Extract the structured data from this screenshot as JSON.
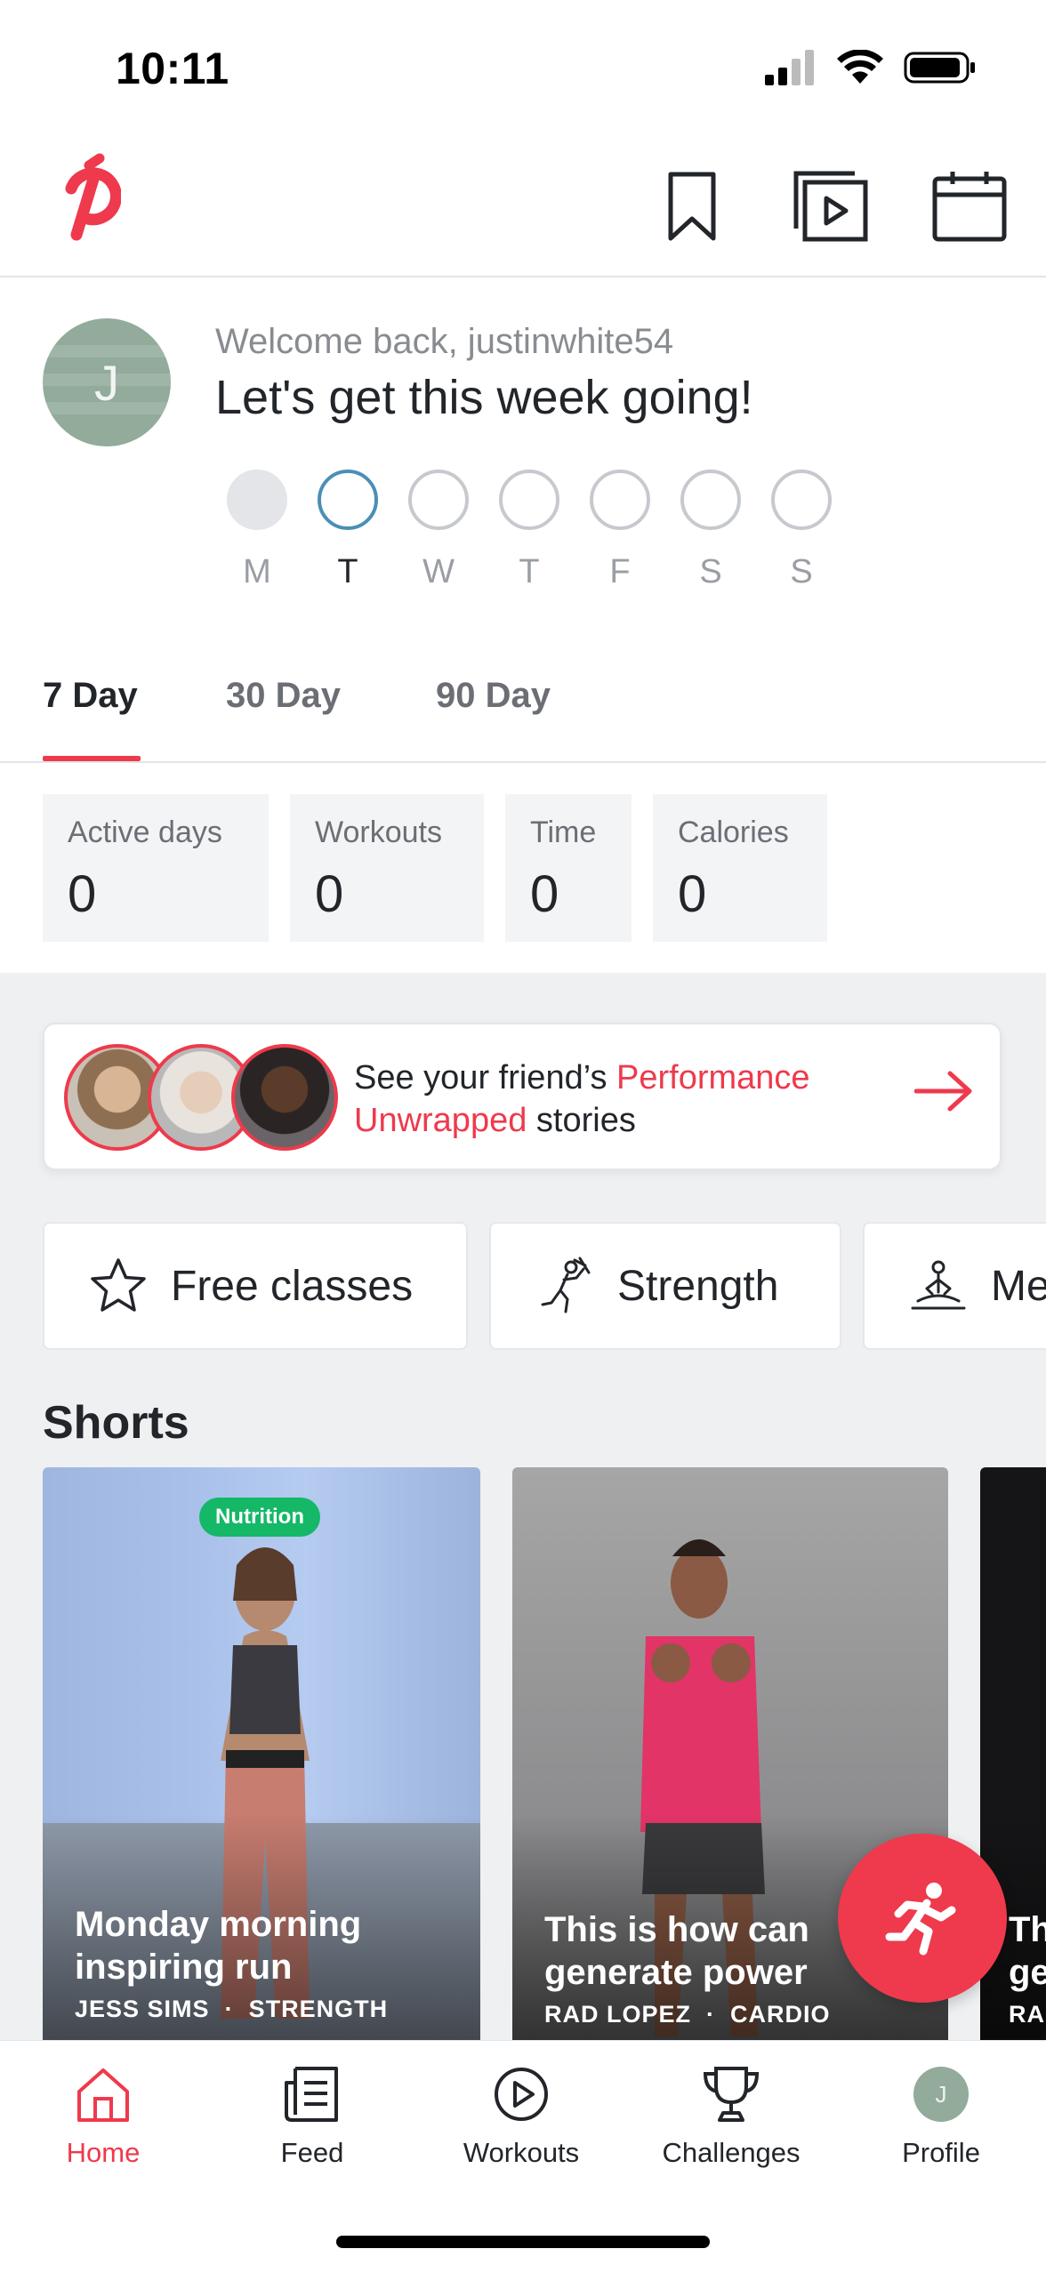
{
  "status_bar": {
    "time": "10:11"
  },
  "header": {
    "icons": [
      "peloton-logo",
      "bookmark-icon",
      "video-library-icon",
      "calendar-icon"
    ]
  },
  "welcome": {
    "avatar_initial": "J",
    "subtitle": "Welcome back, justinwhite54",
    "title": "Let's get this week going!",
    "days": [
      {
        "label": "M",
        "state": "done"
      },
      {
        "label": "T",
        "state": "current"
      },
      {
        "label": "W",
        "state": "upcoming"
      },
      {
        "label": "T",
        "state": "upcoming"
      },
      {
        "label": "F",
        "state": "upcoming"
      },
      {
        "label": "S",
        "state": "upcoming"
      },
      {
        "label": "S",
        "state": "upcoming"
      }
    ]
  },
  "range_tabs": [
    {
      "label": "7 Day",
      "active": true
    },
    {
      "label": "30 Day",
      "active": false
    },
    {
      "label": "90 Day",
      "active": false
    }
  ],
  "stats": [
    {
      "label": "Active days",
      "value": "0"
    },
    {
      "label": "Workouts",
      "value": "0"
    },
    {
      "label": "Time",
      "value": "0"
    },
    {
      "label": "Calories",
      "value": "0"
    }
  ],
  "promo": {
    "text_before": "See your friend’s ",
    "highlight": "Performance Unwrapped",
    "text_after": " stories"
  },
  "categories": [
    {
      "label": "Free classes",
      "icon": "star-icon"
    },
    {
      "label": "Strength",
      "icon": "strength-icon"
    },
    {
      "label": "Me",
      "icon": "meditation-icon"
    }
  ],
  "shorts": {
    "title": "Shorts",
    "cards": [
      {
        "badge": "Nutrition",
        "title": "Monday morning inspiring run",
        "instructor": "JESS SIMS",
        "category": "STRENGTH"
      },
      {
        "badge": "",
        "title": "This is how can generate power",
        "instructor": "RAD LOPEZ",
        "category": "CARDIO"
      },
      {
        "badge": "",
        "title": "Th ge",
        "instructor": "RAD",
        "category": ""
      }
    ]
  },
  "nav": [
    {
      "label": "Home",
      "icon": "home-icon",
      "active": true
    },
    {
      "label": "Feed",
      "icon": "feed-icon",
      "active": false
    },
    {
      "label": "Workouts",
      "icon": "play-circle-icon",
      "active": false
    },
    {
      "label": "Challenges",
      "icon": "trophy-icon",
      "active": false
    },
    {
      "label": "Profile",
      "icon": "profile-avatar",
      "active": false
    }
  ],
  "colors": {
    "accent": "#ee3a4c",
    "badge_green": "#14b866",
    "avatar_green": "#92ab9b",
    "current_day_ring": "#4a8fb7"
  }
}
